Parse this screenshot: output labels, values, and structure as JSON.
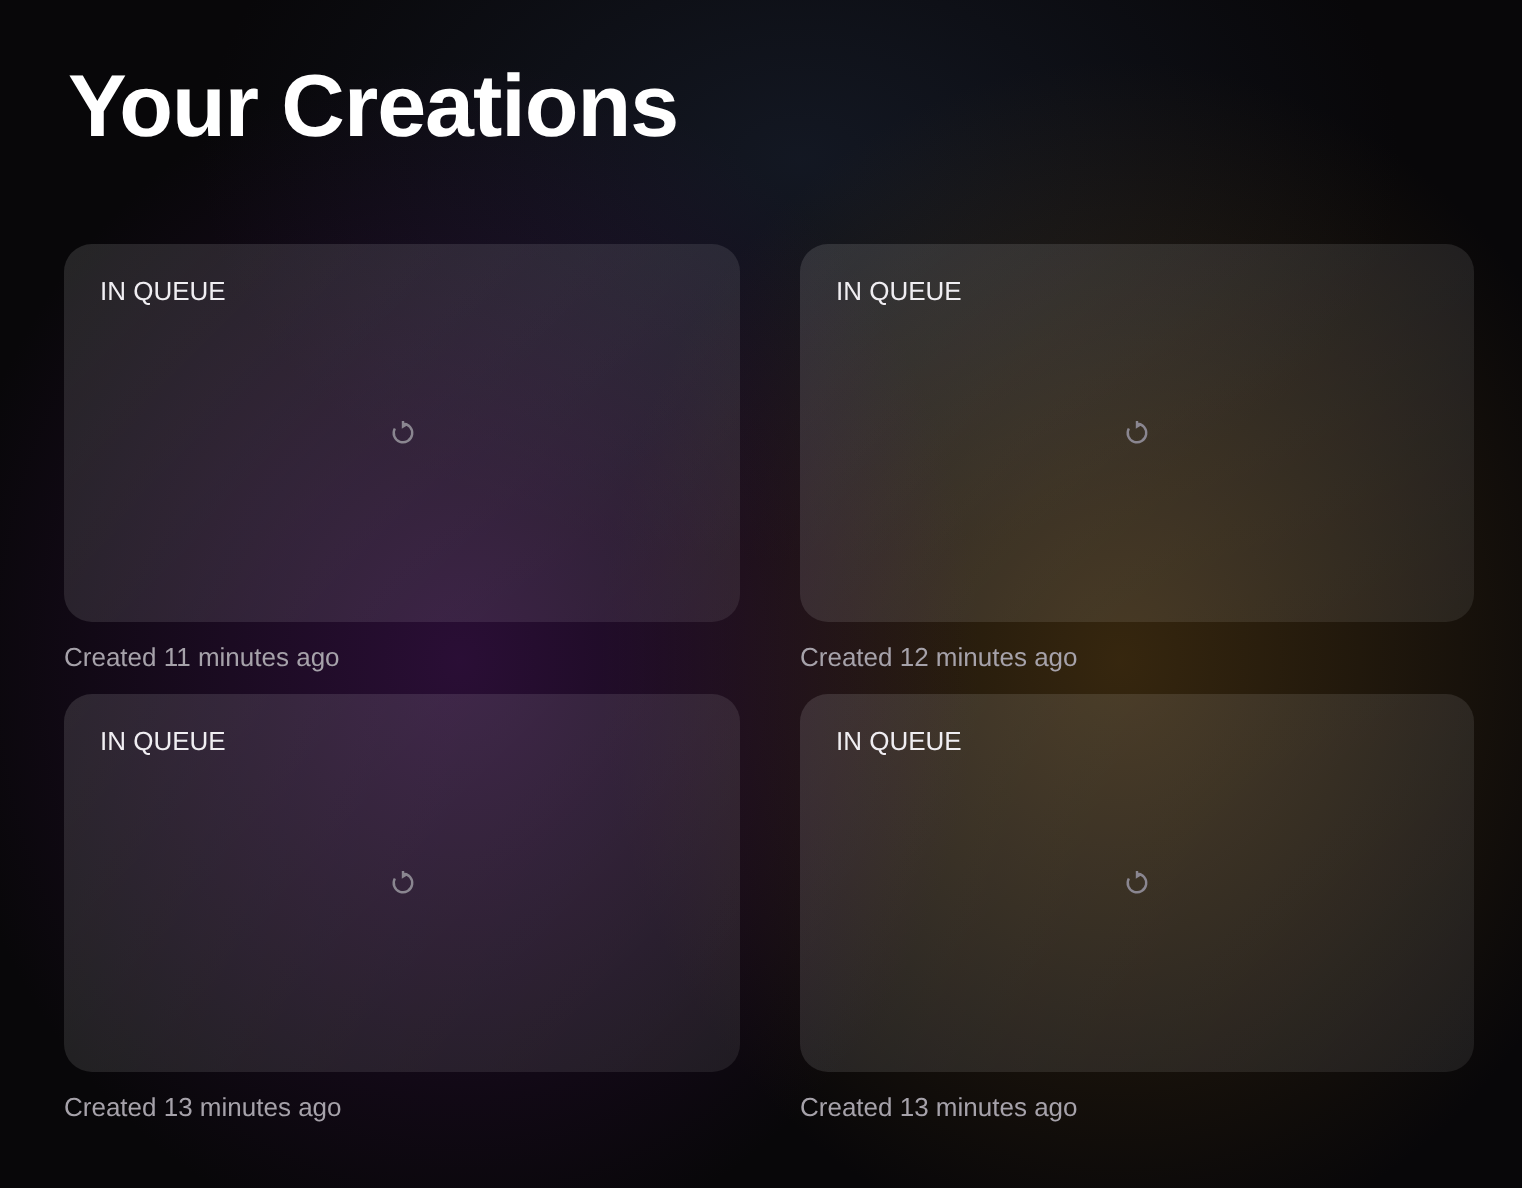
{
  "page": {
    "title": "Your Creations"
  },
  "creations": [
    {
      "status": "IN QUEUE",
      "created": "Created 11 minutes ago"
    },
    {
      "status": "IN QUEUE",
      "created": "Created 12 minutes ago"
    },
    {
      "status": "IN QUEUE",
      "created": "Created 13 minutes ago"
    },
    {
      "status": "IN QUEUE",
      "created": "Created 13 minutes ago"
    }
  ]
}
